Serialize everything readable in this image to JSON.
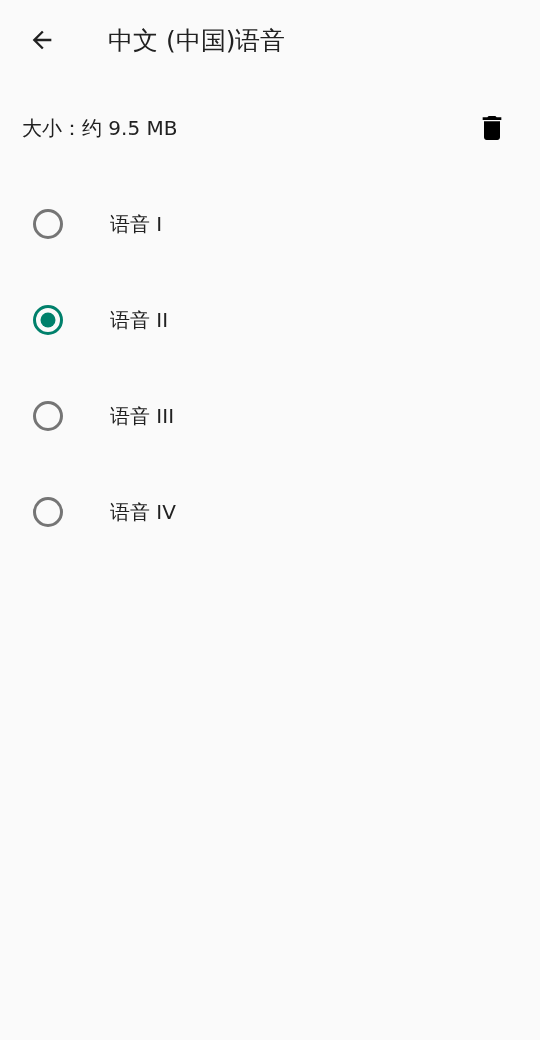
{
  "app_bar": {
    "title": "中文 (中国)语音"
  },
  "size": {
    "label": "大小：约 9.5 MB"
  },
  "voices": [
    {
      "label": "语音 I",
      "selected": false
    },
    {
      "label": "语音 II",
      "selected": true
    },
    {
      "label": "语音 III",
      "selected": false
    },
    {
      "label": "语音 IV",
      "selected": false
    }
  ]
}
